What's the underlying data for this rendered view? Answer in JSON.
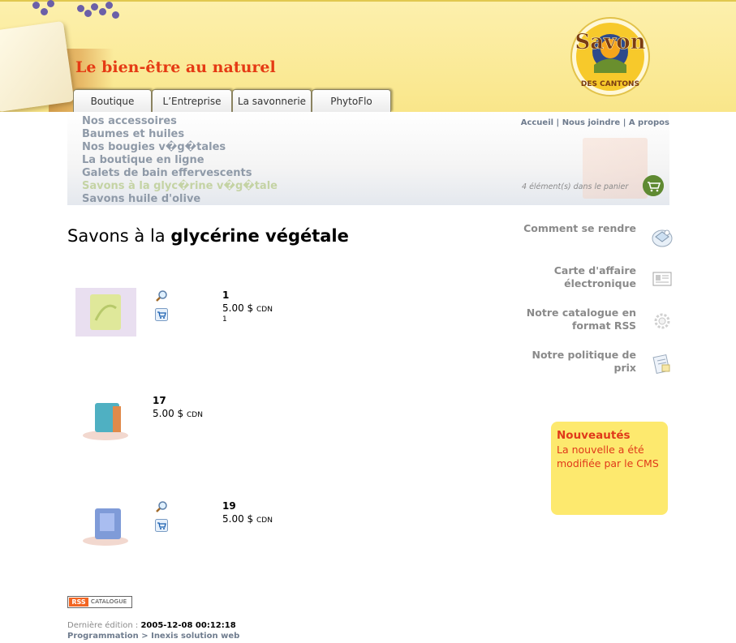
{
  "header": {
    "tagline": "Le bien-être au naturel",
    "logo_text_top": "Savon",
    "logo_text_bottom": "DES CANTONS",
    "tabs": [
      {
        "label": "Boutique"
      },
      {
        "label": "L’Entreprise"
      },
      {
        "label": "La savonnerie"
      },
      {
        "label": "PhytoFlo"
      }
    ]
  },
  "subnav": {
    "items": [
      {
        "label": "Nos accessoires"
      },
      {
        "label": "Baumes et huiles"
      },
      {
        "label": "Nos bougies v�g�tales"
      },
      {
        "label": "La boutique en ligne"
      },
      {
        "label": "Galets de bain effervescents"
      },
      {
        "label": "Savons à la glyc�rine v�g�tale",
        "active": true
      },
      {
        "label": "Savons huile d'olive"
      }
    ],
    "toplinks": {
      "home": "Accueil",
      "join": "Nous joindre",
      "about": "A propos",
      "sep": "|"
    },
    "cart_count": "4 élément(s) dans le panier"
  },
  "main": {
    "title_light": "Savons à la",
    "title_bold": "glycérine végétale",
    "products": [
      {
        "name": "1",
        "price": "5.00 $",
        "currency": "CDN",
        "qty": "1"
      },
      {
        "name": "17",
        "price": "5.00 $",
        "currency": "CDN"
      },
      {
        "name": "19",
        "price": "5.00 $",
        "currency": "CDN"
      }
    ]
  },
  "sidebar": {
    "links": [
      {
        "label": "Comment se rendre",
        "icon": "map-icon"
      },
      {
        "label": "Carte d'affaire électronique",
        "icon": "vcard-icon"
      },
      {
        "label": "Notre catalogue en format RSS",
        "icon": "rss-gear-icon"
      },
      {
        "label": "Notre politique de prix",
        "icon": "price-tag-icon"
      }
    ],
    "news": {
      "title": "Nouveautés",
      "body": "La nouvelle a été modifiée par le CMS"
    }
  },
  "footer": {
    "rss_label": "RSS",
    "catalogue_label": "CATALOGUE",
    "last_edit_label": "Dernière édition :",
    "last_edit_value": "2005-12-08 00:12:18",
    "credits": "Programmation > Inexis solution web"
  },
  "colors": {
    "header_bg": "#fbeb9a",
    "tagline": "#e53a14",
    "subnav_link": "#8f9aa8",
    "subnav_active": "#c4d3a4",
    "news_bg": "#fde96e",
    "news_text": "#e0391a"
  }
}
